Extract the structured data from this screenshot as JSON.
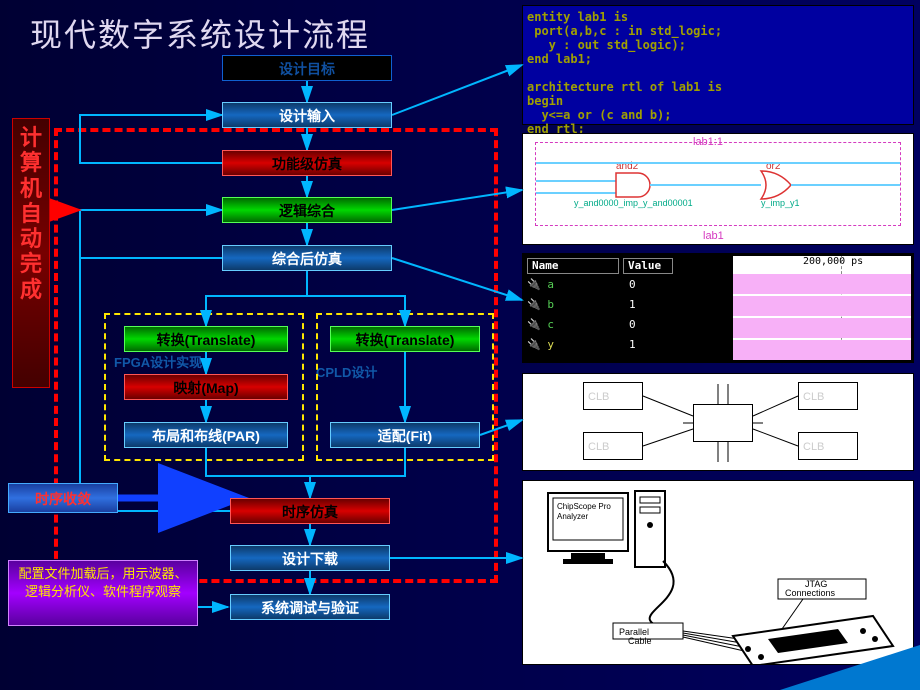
{
  "title": "现代数字系统设计流程",
  "vertical_red_label": "计算机自动完成",
  "flow": {
    "goal": "设计目标",
    "input": "设计输入",
    "funcsim": "功能级仿真",
    "synth": "逻辑综合",
    "post_synth": "综合后仿真",
    "translate1": "转换(Translate)",
    "map": "映射(Map)",
    "par": "布局和布线(PAR)",
    "translate2": "转换(Translate)",
    "fit": "适配(Fit)",
    "timesim": "时序仿真",
    "download": "设计下载",
    "verify": "系统调试与验证",
    "fpga_label": "FPGA设计实现",
    "cpld_label": "CPLD设计"
  },
  "notes": {
    "timing_closure": "时序收敛",
    "config_note": "配置文件加载后，用示波器、逻辑分析仪、软件程序观察"
  },
  "vhdl_code": "entity lab1 is\n port(a,b,c : in std_logic;\n   y : out std_logic);\nend lab1;\n\narchitecture rtl of lab1 is\nbegin\n  y<=a or (c and b);\nend rtl;",
  "schematic": {
    "title_top": "lab1:1",
    "title_bot": "lab1",
    "gate_and": "and2",
    "gate_or": "or2",
    "net1": "y_and0000_imp_y_and00001",
    "net2": "y_imp_y1"
  },
  "sim": {
    "col_name": "Name",
    "col_value": "Value",
    "sigs": [
      "a",
      "b",
      "c",
      "y"
    ],
    "vals": [
      "0",
      "1",
      "0",
      "1"
    ],
    "time_label": "200,000 ps"
  },
  "clb": {
    "label": "CLB"
  },
  "jtag": {
    "chip_label": "ChipScope Pro",
    "pc_label": "Parallel Cable",
    "jtag_label": "JTAG Connections"
  }
}
